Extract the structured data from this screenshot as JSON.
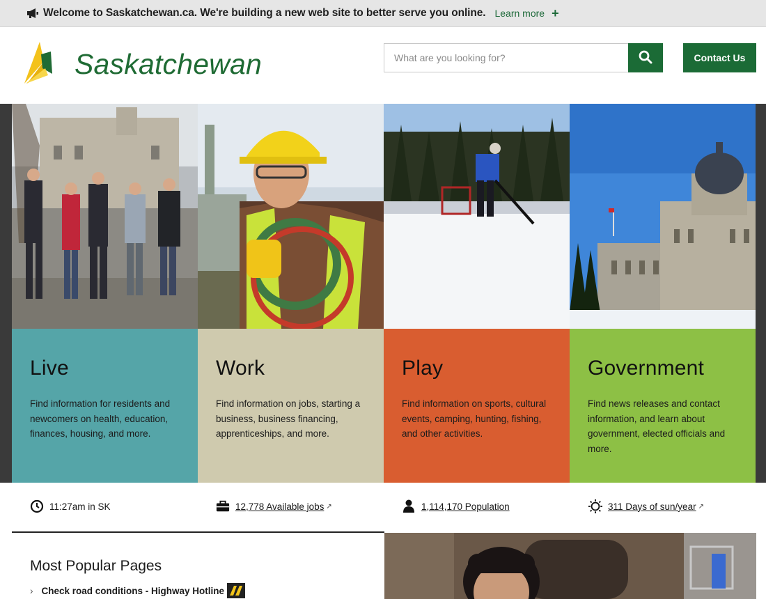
{
  "alert": {
    "icon": "megaphone-icon",
    "text": "Welcome to Saskatchewan.ca. We're building a new web site to better serve you online.",
    "link_label": "Learn more",
    "expand_label": "+"
  },
  "header": {
    "logo_text": "Saskatchewan",
    "search_placeholder": "What are you looking for?",
    "search_icon": "search-icon",
    "contact_label": "Contact Us"
  },
  "tiles": [
    {
      "title": "Live",
      "description": "Find information for residents and newcomers on health, education, finances, housing, and more.",
      "color": "#55a5a8"
    },
    {
      "title": "Work",
      "description": "Find information on jobs, starting a business, business financing, apprenticeships, and more.",
      "color": "#cfcaae"
    },
    {
      "title": "Play",
      "description": "Find information on sports, cultural events, camping, hunting, fishing, and other activities.",
      "color": "#d95d30"
    },
    {
      "title": "Government",
      "description": "Find news releases and contact information, and learn about government, elected officials and more.",
      "color": "#8dc045"
    }
  ],
  "stats": {
    "time": {
      "icon": "clock-icon",
      "label": "11:27am in SK"
    },
    "jobs": {
      "icon": "briefcase-icon",
      "label": "12,778 Available jobs"
    },
    "population": {
      "icon": "person-icon",
      "label": "1,114,170 Population"
    },
    "sun": {
      "icon": "sun-icon",
      "label": "311 Days of sun/year"
    }
  },
  "popular": {
    "title": "Most Popular Pages",
    "items": [
      {
        "label": "Check road conditions - Highway Hotline",
        "icon": "highway-hotline-icon"
      }
    ]
  },
  "colors": {
    "brand_green": "#1b6b36",
    "banner_bg": "#e6e6e6"
  }
}
